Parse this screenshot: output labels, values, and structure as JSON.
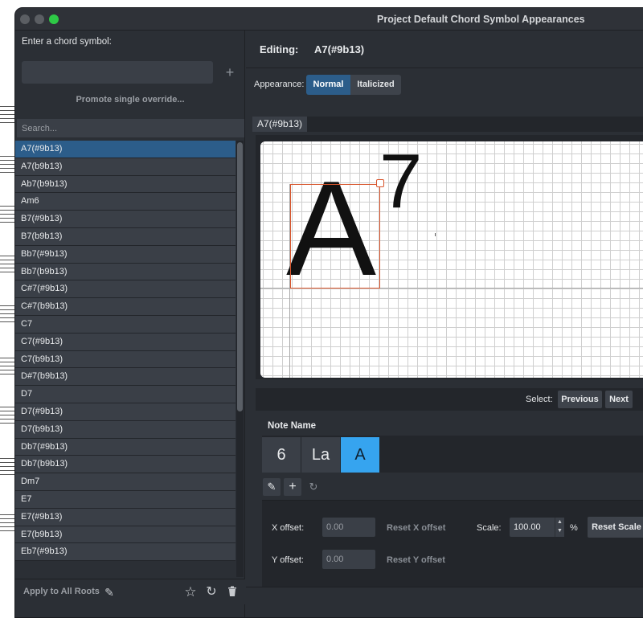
{
  "window": {
    "title": "Project Default Chord Symbol Appearances"
  },
  "left_panel": {
    "enter_label": "Enter a chord symbol:",
    "enter_value": "",
    "add_glyph": "+",
    "promote_label": "Promote single override...",
    "search_placeholder": "Search...",
    "items": [
      "A7(#9b13)",
      "A7(b9b13)",
      "Ab7(b9b13)",
      "Am6",
      "B7(#9b13)",
      "B7(b9b13)",
      "Bb7(#9b13)",
      "Bb7(b9b13)",
      "C#7(#9b13)",
      "C#7(b9b13)",
      "C7",
      "C7(#9b13)",
      "C7(b9b13)",
      "D#7(b9b13)",
      "D7",
      "D7(#9b13)",
      "D7(b9b13)",
      "Db7(#9b13)",
      "Db7(b9b13)",
      "Dm7",
      "E7",
      "E7(#9b13)",
      "E7(b9b13)",
      "Eb7(#9b13)"
    ],
    "selected_index": 0,
    "apply_label": "Apply to All Roots"
  },
  "editor": {
    "editing_label": "Editing:",
    "editing_value": "A7(#9b13)",
    "appearance_label": "Appearance:",
    "appearance_options": [
      "Normal",
      "Italicized"
    ],
    "appearance_selected": "Normal",
    "tab_label": "A7(#9b13)",
    "preview_root": "A",
    "preview_ext": "7",
    "select_label": "Select:",
    "previous_label": "Previous",
    "next_label": "Next",
    "section_title": "Note Name",
    "note_cells": [
      "6",
      "La",
      "A"
    ],
    "note_selected": "A",
    "x_offset_label": "X offset:",
    "x_offset_value": "0.00",
    "reset_x_label": "Reset X offset",
    "y_offset_label": "Y offset:",
    "y_offset_value": "0.00",
    "reset_y_label": "Reset Y offset",
    "scale_label": "Scale:",
    "scale_value": "100.00",
    "scale_unit": "%",
    "reset_scale_label": "Reset Scale"
  },
  "icons": {
    "pencil": "✎",
    "plus": "+",
    "reset": "↻",
    "star": "☆",
    "trash": "🗑",
    "up": "▲",
    "down": "▼"
  },
  "colors": {
    "accent": "#2c5d8a",
    "note_active": "#36a4ef",
    "selection_box": "#d8552c",
    "traffic_green": "#2ec946"
  }
}
